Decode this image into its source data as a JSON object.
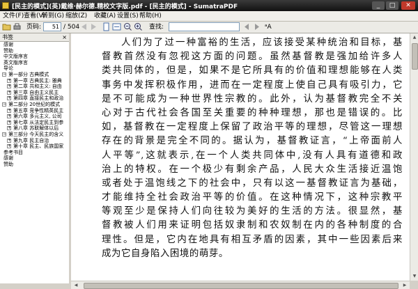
{
  "window": {
    "title": "[民主的模式](英)戴维·赫尔德.精校文字版.pdf - [民主的模式] - SumatraPDF"
  },
  "menu": [
    "文件(F)",
    "查看(V)",
    "转到(G)",
    "缩放(Z)",
    "收藏(A)",
    "设置(S)",
    "帮助(H)"
  ],
  "toolbar": {
    "page_label": "页码:",
    "page_value": "51",
    "page_total": "/ 504",
    "find_label": "查找:",
    "find_value": "",
    "match_case_label": "ᵃA"
  },
  "sidebar": {
    "header": "书签",
    "close": "×",
    "items": [
      {
        "text": "感谢",
        "level": 0,
        "expander": ""
      },
      {
        "text": "赞助",
        "level": 0,
        "expander": ""
      },
      {
        "text": "中文版序言",
        "level": 0,
        "expander": ""
      },
      {
        "text": "英文版序言",
        "level": 0,
        "expander": ""
      },
      {
        "text": "导论",
        "level": 0,
        "expander": ""
      },
      {
        "text": "第一部分 古典模式",
        "level": 0,
        "expander": "−"
      },
      {
        "text": "第一章 古典民主: 雅典",
        "level": 1,
        "expander": "+"
      },
      {
        "text": "第二章 共和主义: 自由",
        "level": 1,
        "expander": "+"
      },
      {
        "text": "第三章 自由主义民主",
        "level": 1,
        "expander": "+"
      },
      {
        "text": "第四章 直接民主和政治",
        "level": 1,
        "expander": "+"
      },
      {
        "text": "第二部分 20世纪的模式",
        "level": 0,
        "expander": "−"
      },
      {
        "text": "第五章 竞争性精英民主",
        "level": 1,
        "expander": "+"
      },
      {
        "text": "第六章 多元主义, 公司",
        "level": 1,
        "expander": "+"
      },
      {
        "text": "第七章 从法定民主到参",
        "level": 1,
        "expander": "+"
      },
      {
        "text": "第八章 苏联解体以后",
        "level": 1,
        "expander": "+"
      },
      {
        "text": "第三部分 今天民主的含义",
        "level": 0,
        "expander": "−"
      },
      {
        "text": "第九章 民主自治",
        "level": 1,
        "expander": "+"
      },
      {
        "text": "第十章 民主、民族国家",
        "level": 1,
        "expander": "+"
      },
      {
        "text": "参考书目",
        "level": 0,
        "expander": ""
      },
      {
        "text": "感谢",
        "level": 0,
        "expander": ""
      },
      {
        "text": "赞助",
        "level": 0,
        "expander": ""
      }
    ]
  },
  "document": {
    "lines": [
      "人们为了过一种富裕的生活，应该接受某种统治和目标，基",
      "督教首然没有忽视这方面的问题。虽然基督教是强加给许多人",
      "类共同体的，但是，如果不是它所具有的价值和理想能够在人类",
      "事务中发挥积极作用，进而在一定程度上使自己具有吸引力，它",
      "是不可能成为一种世界性宗教的。此外，认为基督教完全不关",
      "心对于古代社会各国至关重要的种种理想，那也是错误的。比",
      "如，基督教在一定程度上保留了政治平等的理想，尽管这一理想",
      "存在的背景是完全不同的。据认为，基督教证言，“上帝面前人",
      "人平等”,这就表示,在一个人类共同体中,没有人具有道德和政",
      "治上的特权。在一个极少有剩余产品，人民大众生活接近温饱",
      "或者处于温饱线之下的社会中，只有以这一基督教证言为基础，",
      "才能维持全社会政治平等的价值。在这种情况下，这种宗教平",
      "等观至少是保持人们向往较为美好的生活的方法。很显然，基",
      "督教被人们用来证明包括奴隶制和农奴制在内的各种制度的合",
      "理性。但是，它内在地具有相互矛盾的因素，其中一些因素后来",
      "成为它自身陷入困境的萌芽。"
    ]
  },
  "colors": {
    "titlebar": "#1a1a1a",
    "close_button": "#c0392b",
    "app_icon": "#e8c33a"
  }
}
